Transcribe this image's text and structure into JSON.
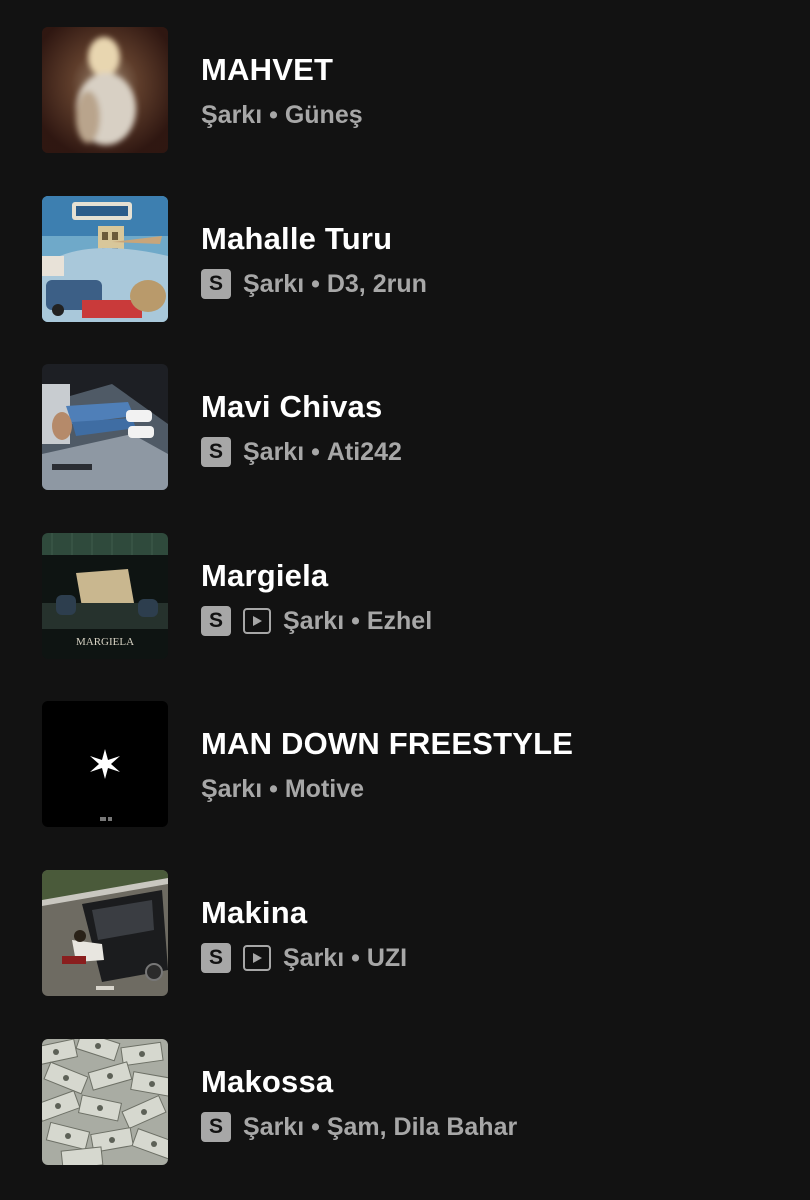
{
  "tracks": [
    {
      "title": "MAHVET",
      "type": "Şarkı",
      "sep": "•",
      "artist": "Güneş",
      "badges": {
        "s": false,
        "video": false
      },
      "art_icon": "album-art-blurred-person"
    },
    {
      "title": "Mahalle Turu",
      "type": "Şarkı",
      "sep": "•",
      "artist": "D3, 2run",
      "badges": {
        "s": true,
        "video": false
      },
      "art_icon": "album-art-collage",
      "s_label": "S"
    },
    {
      "title": "Mavi Chivas",
      "type": "Şarkı",
      "sep": "•",
      "artist": "Ati242",
      "badges": {
        "s": true,
        "video": false
      },
      "art_icon": "album-art-car-interior",
      "s_label": "S"
    },
    {
      "title": "Margiela",
      "type": "Şarkı",
      "sep": "•",
      "artist": "Ezhel",
      "badges": {
        "s": true,
        "video": true
      },
      "art_icon": "album-art-margiela",
      "s_label": "S",
      "art_text": "MARGIELA"
    },
    {
      "title": "MAN DOWN FREESTYLE",
      "type": "Şarkı",
      "sep": "•",
      "artist": "Motive",
      "badges": {
        "s": false,
        "video": false
      },
      "art_icon": "album-art-star"
    },
    {
      "title": "Makina",
      "type": "Şarkı",
      "sep": "•",
      "artist": "UZI",
      "badges": {
        "s": true,
        "video": true
      },
      "art_icon": "album-art-car-crash",
      "s_label": "S"
    },
    {
      "title": "Makossa",
      "type": "Şarkı",
      "sep": "•",
      "artist": "Şam, Dila Bahar",
      "badges": {
        "s": true,
        "video": false
      },
      "art_icon": "album-art-money",
      "s_label": "S"
    }
  ],
  "colors": {
    "background": "#121212",
    "title": "#ffffff",
    "subtitle": "#a7a7a7"
  }
}
